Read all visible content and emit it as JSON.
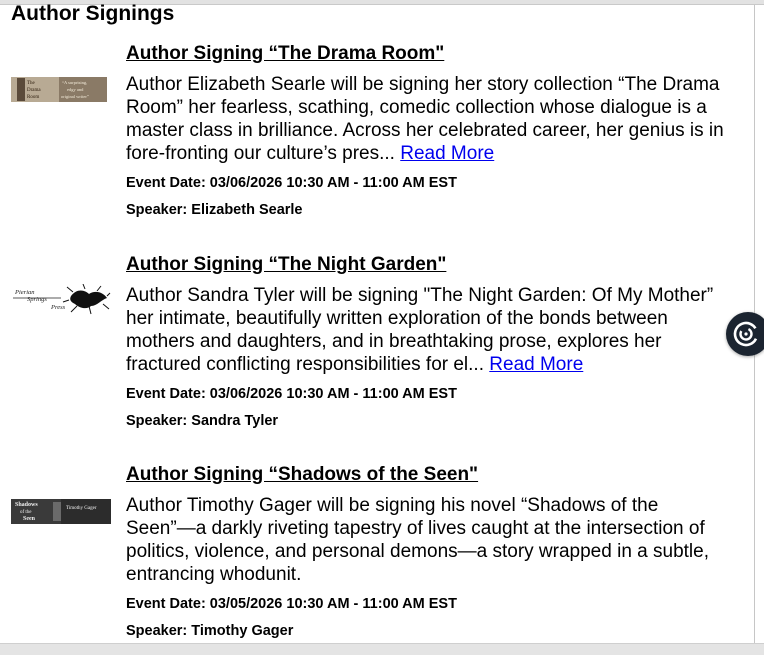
{
  "page": {
    "heading": "Author Signings"
  },
  "events": [
    {
      "title": "Author Signing “The Drama Room\"",
      "description": "Author Elizabeth Searle will be signing her story collection “The Drama Room” her fearless, scathing, comedic collection whose dialogue is a master class in brilliance. Across her celebrated career, her genius is in fore-fronting our culture’s pres...",
      "read_more": "Read More",
      "event_date": "Event Date: 03/06/2026 10:30 AM - 11:00 AM EST",
      "speaker": "Speaker: Elizabeth Searle",
      "thumbnail": {
        "left_text_1": "The",
        "left_text_2": "Drama",
        "left_text_3": "Room",
        "right_text_1": "“A surprising,",
        "right_text_2": "edgy and",
        "right_text_3": "original writer”"
      }
    },
    {
      "title": "Author Signing “The Night Garden\"",
      "description": "Author Sandra Tyler will be signing \"The Night Garden: Of My Mother” her intimate, beautifully written exploration of the bonds between mothers and daughters, and in breathtaking prose, explores her fractured conflicting responsibilities for el...",
      "read_more": "Read More",
      "event_date": "Event Date: 03/06/2026 10:30 AM - 11:00 AM EST",
      "speaker": "Speaker: Sandra Tyler",
      "thumbnail": {
        "text_1": "Pierian",
        "text_2": "Springs",
        "text_3": "Press"
      }
    },
    {
      "title": "Author Signing “Shadows of the Seen\"",
      "description": "Author Timothy Gager will be signing his novel “Shadows of the Seen”—a darkly riveting tapestry of lives caught at the intersection of politics, violence, and personal demons—a story wrapped in a subtle, entrancing whodunit.",
      "event_date": "Event Date: 03/05/2026 10:30 AM - 11:00 AM EST",
      "speaker": "Speaker: Timothy Gager",
      "thumbnail": {
        "title_1": "Shadows",
        "title_2": "of the",
        "title_3": "Seen",
        "author": "Timothy Gager"
      }
    }
  ],
  "colors": {
    "link": "#0000ee",
    "fab_background": "#1b2430"
  },
  "icons": {
    "fab": "assistant-swirl-icon"
  }
}
